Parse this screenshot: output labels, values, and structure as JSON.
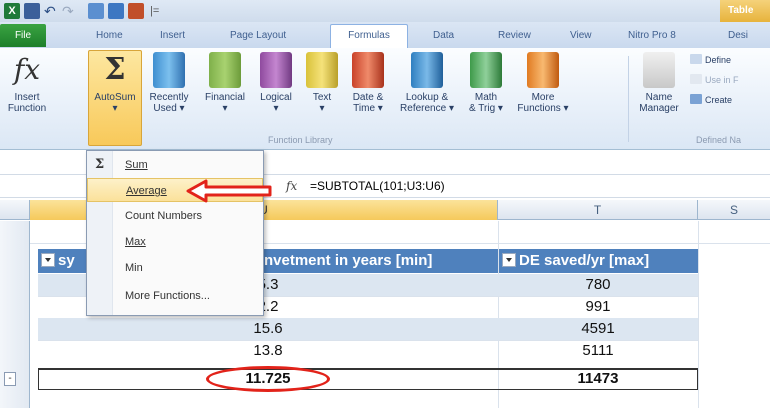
{
  "qat": {
    "app_icon": "X",
    "undo_glyph": "↶",
    "redo_glyph": "↷",
    "separator": "|=",
    "context_tab": "Table"
  },
  "tabs": [
    "File",
    "Home",
    "Insert",
    "Page Layout",
    "Formulas",
    "Data",
    "Review",
    "View",
    "Nitro Pro 8",
    "Desi"
  ],
  "active_tab": "Formulas",
  "ribbon": {
    "insert_function": {
      "line1": "Insert",
      "line2": "Function",
      "glyph": "fx"
    },
    "autosum": {
      "line1": "AutoSum",
      "line2": "▾",
      "glyph": "Σ"
    },
    "recently_used": {
      "line1": "Recently",
      "line2": "Used ▾"
    },
    "financial": {
      "line1": "Financial",
      "line2": "▾"
    },
    "logical": {
      "line1": "Logical",
      "line2": "▾"
    },
    "text": {
      "line1": "Text",
      "line2": "▾"
    },
    "date_time": {
      "line1": "Date &",
      "line2": "Time ▾"
    },
    "lookup": {
      "line1": "Lookup &",
      "line2": "Reference ▾"
    },
    "math": {
      "line1": "Math",
      "line2": "& Trig ▾"
    },
    "more": {
      "line1": "More",
      "line2": "Functions ▾"
    },
    "function_library_label": "Function Library",
    "name_manager": {
      "line1": "Name",
      "line2": "Manager"
    },
    "define_name": "Define",
    "use_in_formula": "Use in F",
    "create_from_selection": "Create",
    "defined_names_label": "Defined Na"
  },
  "formula_bar": {
    "fx": "fx",
    "formula": "=SUBTOTAL(101;U3:U6)"
  },
  "columns": {
    "u": "U",
    "t": "T",
    "s": "S"
  },
  "table": {
    "header_left": "sy",
    "header_u": "nvetment in years [min]",
    "header_t": "DE saved/yr [max]",
    "u_values": [
      "5.3",
      "2.2",
      "15.6",
      "13.8"
    ],
    "t_values": [
      "780",
      "991",
      "4591",
      "5111"
    ],
    "total_u": "11.725",
    "total_t": "11473",
    "row_marker": "-"
  },
  "menu": {
    "items": [
      {
        "label": "Sum",
        "highlight": false
      },
      {
        "label": "Average",
        "highlight": true
      },
      {
        "label": "Count Numbers",
        "highlight": false
      },
      {
        "label": "Max",
        "highlight": false
      },
      {
        "label": "Min",
        "highlight": false
      },
      {
        "label": "More Functions...",
        "highlight": false
      }
    ],
    "sigma_glyph": "Σ"
  },
  "colors": {
    "accent_red": "#e2231a",
    "table_header": "#4f81bd",
    "band": "#dce6f1",
    "file_tab": "#1d7f2a"
  }
}
